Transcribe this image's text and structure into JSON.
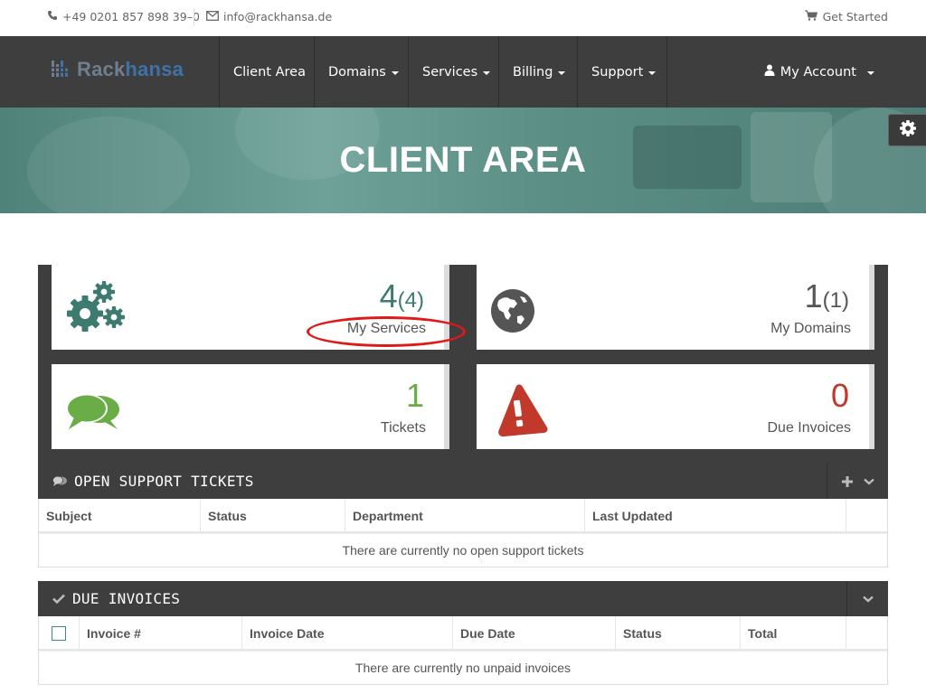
{
  "topbar": {
    "phone": "+49 0201 857 898 39–0",
    "email": "info@rackhansa.de",
    "get_started": "Get Started"
  },
  "logo": {
    "part1": "Rack",
    "part2": "hansa"
  },
  "nav": {
    "items": [
      {
        "label": "Client Area"
      },
      {
        "label": "Domains"
      },
      {
        "label": "Services"
      },
      {
        "label": "Billing"
      },
      {
        "label": "Support"
      }
    ],
    "account": "My Account"
  },
  "hero": {
    "title": "CLIENT AREA"
  },
  "tiles": {
    "services": {
      "count": "4",
      "total": "(4)",
      "label": "My Services",
      "color": "#3d7a6f"
    },
    "domains": {
      "count": "1",
      "total": "(1)",
      "label": "My Domains",
      "color": "#555555"
    },
    "tickets": {
      "count": "1",
      "label": "Tickets",
      "color": "#6aac45"
    },
    "invoices": {
      "count": "0",
      "label": "Due Invoices",
      "color": "#c0392b"
    }
  },
  "support_tickets": {
    "title": "OPEN SUPPORT TICKETS",
    "columns": [
      "Subject",
      "Status",
      "Department",
      "Last Updated"
    ],
    "empty": "There are currently no open support tickets"
  },
  "due_invoices": {
    "title": "DUE INVOICES",
    "columns": [
      "Invoice #",
      "Invoice Date",
      "Due Date",
      "Status",
      "Total"
    ],
    "empty": "There are currently no unpaid invoices"
  },
  "colors": {
    "navbar": "#3e3e3e",
    "hero": "#5e9189",
    "accent": "#3d7a6f",
    "highlight": "#e01818"
  }
}
